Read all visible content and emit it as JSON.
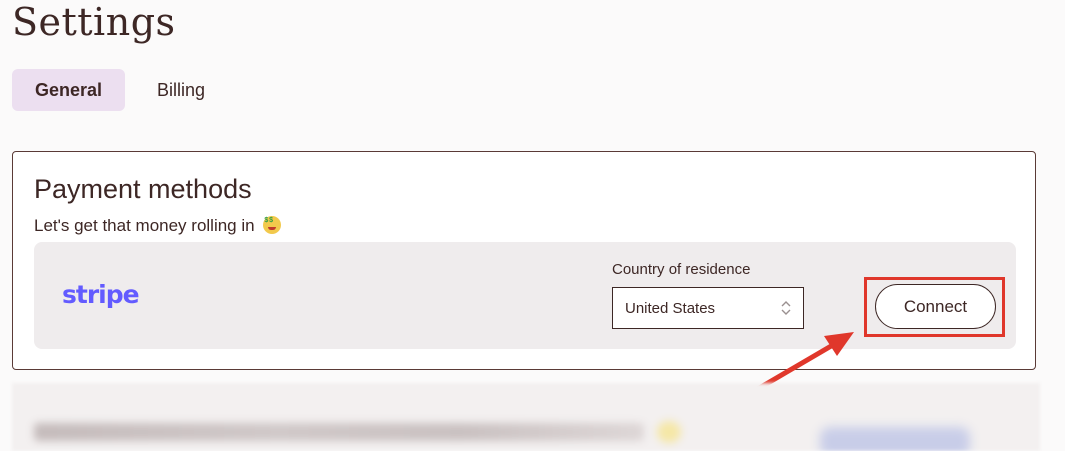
{
  "header": {
    "title": "Settings"
  },
  "tabs": [
    {
      "label": "General",
      "active": true
    },
    {
      "label": "Billing",
      "active": false
    }
  ],
  "payment_card": {
    "title": "Payment methods",
    "subtitle": "Let's get that money rolling in",
    "subtitle_emoji_icon": "money-mouth-face-icon",
    "provider": {
      "logo_text": "stripe",
      "logo_color": "#635bff",
      "country_label": "Country of residence",
      "country_value": "United States",
      "connect_label": "Connect"
    }
  },
  "annotation": {
    "highlight_color": "#e0372b",
    "arrow_icon": "red-arrow-icon"
  },
  "colors": {
    "active_tab_bg": "#ecdff0",
    "text": "#3d2725",
    "row_bg": "#efeced"
  }
}
